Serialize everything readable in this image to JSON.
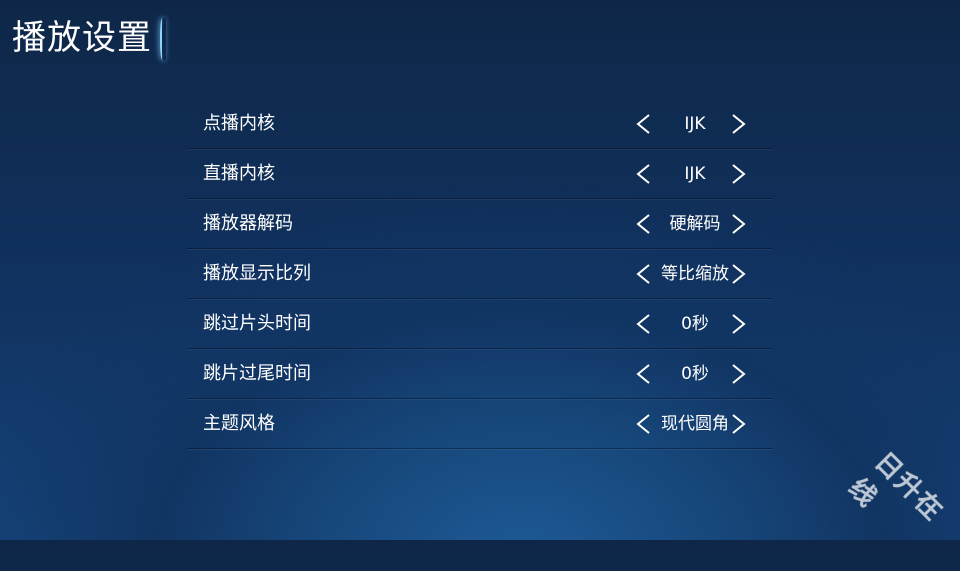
{
  "header": {
    "title": "播放设置"
  },
  "settings": [
    {
      "label": "点播内核",
      "value": "IJK"
    },
    {
      "label": "直播内核",
      "value": "IJK"
    },
    {
      "label": "播放器解码",
      "value": "硬解码"
    },
    {
      "label": "播放显示比列",
      "value": "等比缩放"
    },
    {
      "label": "跳过片头时间",
      "value": "0秒"
    },
    {
      "label": "跳片过尾时间",
      "value": "0秒"
    },
    {
      "label": "主题风格",
      "value": "现代圆角"
    }
  ],
  "icons": {
    "previous": "chevron-left-icon",
    "next": "chevron-right-icon"
  },
  "watermark": {
    "text": "日升在线"
  },
  "colors": {
    "background_top": "#0e2748",
    "background_bottom": "#1e5a96",
    "text": "#ffffff",
    "accent": "#8fd4ff"
  }
}
